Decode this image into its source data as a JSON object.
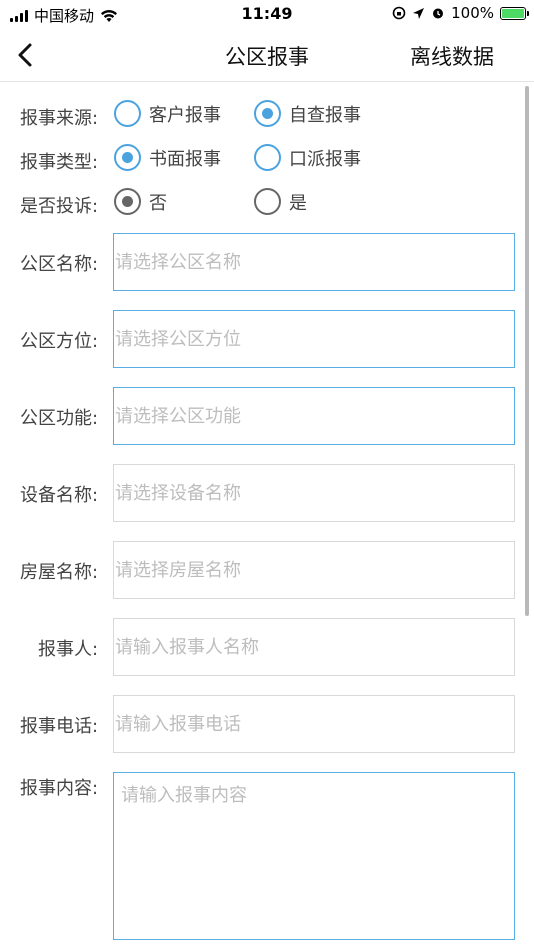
{
  "status_bar": {
    "carrier": "中国移动",
    "time": "11:49",
    "battery": "100%"
  },
  "nav": {
    "title": "公区报事",
    "right_label": "离线数据"
  },
  "report_source": {
    "label": "报事来源:",
    "options": [
      {
        "label": "客户报事",
        "checked": false
      },
      {
        "label": "自查报事",
        "checked": true
      }
    ]
  },
  "report_type": {
    "label": "报事类型:",
    "options": [
      {
        "label": "书面报事",
        "checked": true
      },
      {
        "label": "口派报事",
        "checked": false
      }
    ]
  },
  "complaint": {
    "label": "是否投诉:",
    "options": [
      {
        "label": "否",
        "checked": true
      },
      {
        "label": "是",
        "checked": false
      }
    ]
  },
  "fields": {
    "area_name": {
      "label": "公区名称:",
      "placeholder": "请选择公区名称",
      "value": ""
    },
    "area_position": {
      "label": "公区方位:",
      "placeholder": "请选择公区方位",
      "value": ""
    },
    "area_function": {
      "label": "公区功能:",
      "placeholder": "请选择公区功能",
      "value": ""
    },
    "device_name": {
      "label": "设备名称:",
      "placeholder": "请选择设备名称",
      "value": ""
    },
    "house_name": {
      "label": "房屋名称:",
      "placeholder": "请选择房屋名称",
      "value": ""
    },
    "reporter": {
      "label": "报事人:",
      "placeholder": "请输入报事人名称",
      "value": ""
    },
    "phone": {
      "label": "报事电话:",
      "placeholder": "请输入报事电话",
      "value": ""
    },
    "content": {
      "label": "报事内容:",
      "placeholder": "请输入报事内容",
      "value": ""
    }
  },
  "colors": {
    "accent": "#4aa3df",
    "border": "#d9d9d9",
    "placeholder": "#bdbdbd"
  }
}
